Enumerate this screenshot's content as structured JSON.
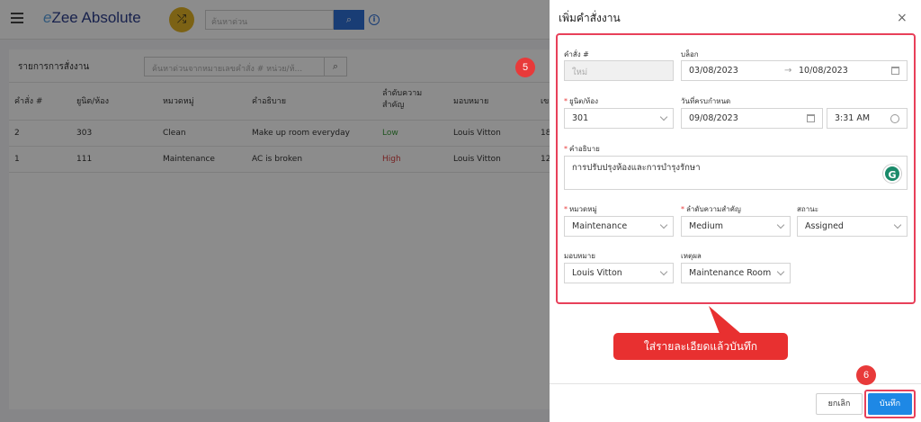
{
  "app": {
    "logo_prefix": "e",
    "logo_text": "Zee Absolute",
    "search_placeholder": "ค้นหาด่วน"
  },
  "list": {
    "title": "รายการการสั่งงาน",
    "search_placeholder": "ค้นหาด่วนจากหมายเลขคำสั่ง # หน่วย/ห้...",
    "columns": [
      "คำสั่ง #",
      "ยูนิต/ห้อง",
      "หมวดหมู่",
      "คำอธิบาย",
      "ลำดับความ",
      "สำคัญ",
      "มอบหมาย",
      "เข"
    ],
    "rows": [
      {
        "order": "2",
        "unit": "303",
        "category": "Clean",
        "description": "Make up room everyday",
        "priority": "Low",
        "assignee": "Louis Vitton",
        "extra": "18"
      },
      {
        "order": "1",
        "unit": "111",
        "category": "Maintenance",
        "description": "AC is broken",
        "priority": "High",
        "assignee": "Louis Vitton",
        "extra": "12"
      }
    ]
  },
  "steps": {
    "step5": "5",
    "step6": "6"
  },
  "drawer": {
    "title": "เพิ่มคำสั่งงาน",
    "close": "×",
    "order_label": "คำสั่ง #",
    "order_value": "ใหม่",
    "block_label": "บล็อก",
    "block_from": "03/08/2023",
    "block_arrow": "→",
    "block_to": "10/08/2023",
    "unit_label": "ยูนิต/ห้อง",
    "unit_value": "301",
    "due_label": "วันที่ครบกำหนด",
    "due_date": "09/08/2023",
    "due_time": "3:31 AM",
    "desc_label": "คำอธิบาย",
    "desc_value": "การปรับปรุงห้องและการบำรุงรักษา",
    "grammarly": "G",
    "category_label": "หมวดหมู่",
    "category_value": "Maintenance",
    "priority_label": "ลำดับความสำคัญ",
    "priority_value": "Medium",
    "status_label": "สถานะ",
    "status_value": "Assigned",
    "assignee_label": "มอบหมาย",
    "assignee_value": "Louis Vitton",
    "reason_label": "เหตุผล",
    "reason_value": "Maintenance Room",
    "required_mark": "*",
    "cancel_label": "ยกเลิก",
    "save_label": "บันทึก"
  },
  "callout": {
    "text": "ใส่รายละเอียดแล้วบันทึก"
  },
  "colors": {
    "accent": "#1e88e5",
    "highlight": "#e8405a",
    "brand": "#2d3e8c"
  }
}
